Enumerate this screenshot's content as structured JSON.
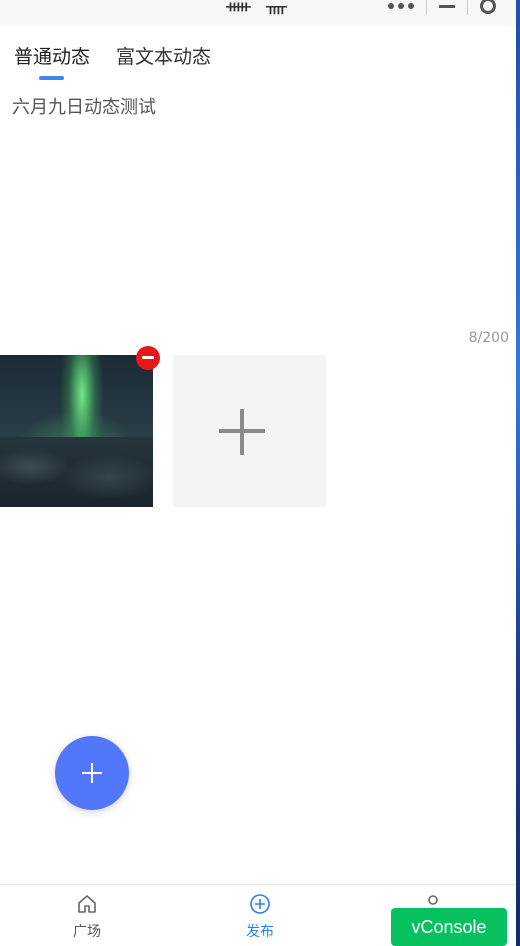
{
  "status_bar": {
    "left_glyph": "ᚔ",
    "mid_glyph": "ᚄ"
  },
  "tabs": [
    {
      "label": "普通动态",
      "active": true
    },
    {
      "label": "富文本动态",
      "active": false
    }
  ],
  "post": {
    "text": "六月九日动态测试",
    "counter": "8/200"
  },
  "images": [
    {
      "icon": "aurora-photo"
    }
  ],
  "fab": {
    "icon": "plus-icon"
  },
  "bottom_nav": [
    {
      "label": "广场",
      "icon": "home-icon",
      "active": false
    },
    {
      "label": "发布",
      "icon": "add-circle-icon",
      "active": true
    },
    {
      "label": "",
      "icon": "user-icon",
      "active": false
    }
  ],
  "vconsole": {
    "label": "vConsole"
  },
  "colors": {
    "accent": "#3a86f5",
    "fab": "#5277fb",
    "remove": "#e81818",
    "vconsole": "#07c160"
  }
}
